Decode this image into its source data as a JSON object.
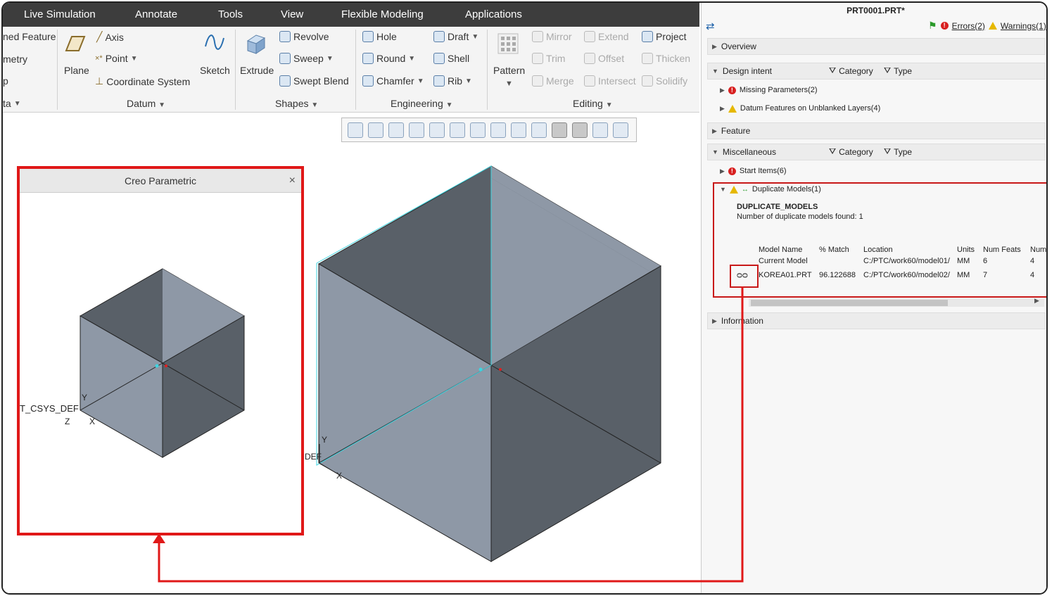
{
  "menubar": {
    "tabs": [
      "Live Simulation",
      "Annotate",
      "Tools",
      "View",
      "Flexible Modeling",
      "Applications"
    ]
  },
  "ribbon": {
    "partial_left": {
      "item1": "ned Feature",
      "item2": "metry",
      "item3": "p",
      "item4": "ta"
    },
    "datum": {
      "plane": "Plane",
      "axis": "Axis",
      "point": "Point",
      "csys": "Coordinate System",
      "sketch": "Sketch",
      "group": "Datum"
    },
    "shapes": {
      "extrude": "Extrude",
      "revolve": "Revolve",
      "sweep": "Sweep",
      "swept_blend": "Swept Blend",
      "group": "Shapes"
    },
    "engineering": {
      "hole": "Hole",
      "round": "Round",
      "chamfer": "Chamfer",
      "draft": "Draft",
      "shell": "Shell",
      "rib": "Rib",
      "group": "Engineering"
    },
    "editing": {
      "pattern": "Pattern",
      "mirror": "Mirror",
      "trim": "Trim",
      "merge": "Merge",
      "extend": "Extend",
      "offset": "Offset",
      "intersect": "Intersect",
      "project": "Project",
      "thicken": "Thicken",
      "solidify": "Solidify",
      "group": "Editing"
    }
  },
  "popup": {
    "title": "Creo Parametric",
    "close": "×",
    "csys_label": "T_CSYS_DEF",
    "axis_y": "Y",
    "axis_z": "Z",
    "axis_x": "X"
  },
  "main_view": {
    "csys_label": "DEF",
    "axis_y": "Y",
    "axis_x": "X"
  },
  "panel": {
    "title": "PRT0001.PRT*",
    "errors": "Errors(2)",
    "warnings": "Warnings(1)",
    "sections": {
      "overview": "Overview",
      "design_intent": "Design intent",
      "feature": "Feature",
      "misc": "Miscellaneous",
      "information": "Information"
    },
    "filters": {
      "category": "Category",
      "type": "Type"
    },
    "design_items": [
      "Missing Parameters(2)",
      "Datum Features on Unblanked Layers(4)"
    ],
    "misc_items": {
      "start": "Start Items(6)",
      "duplicate": "Duplicate Models(1)"
    },
    "dup": {
      "title": "DUPLICATE_MODELS",
      "desc": "Number of duplicate models found: 1",
      "headers": [
        "Model Name",
        "% Match",
        "Location",
        "Units",
        "Num Feats",
        "Num"
      ],
      "rows": [
        [
          "Current Model",
          "",
          "C:/PTC/work60/model01/",
          "MM",
          "6",
          "4"
        ],
        [
          "KOREA01.PRT",
          "96.122688",
          "C:/PTC/work60/model02/",
          "MM",
          "7",
          "4"
        ]
      ]
    }
  },
  "colors": {
    "accent_red": "#e01818",
    "menubar": "#3d3d3d",
    "cube_dark": "#596068",
    "cube_light": "#8e98a6"
  }
}
